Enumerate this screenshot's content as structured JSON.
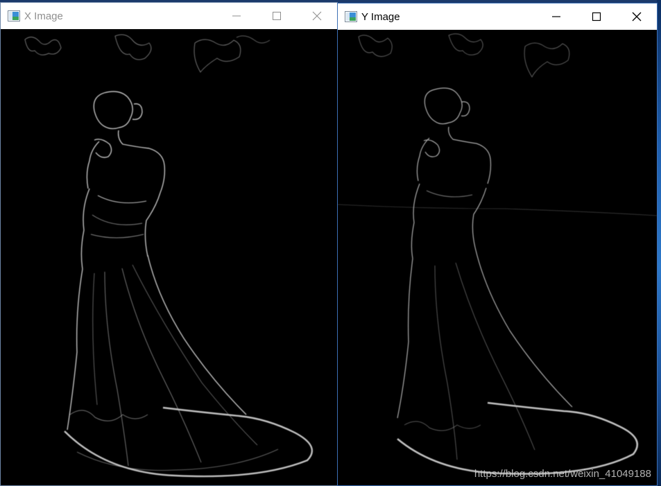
{
  "windows": [
    {
      "id": "x",
      "title": "X Image",
      "active": false,
      "buttons": {
        "minimize": "minimize",
        "maximize": "maximize",
        "close": "close"
      }
    },
    {
      "id": "y",
      "title": "Y Image",
      "active": true,
      "buttons": {
        "minimize": "minimize",
        "maximize": "maximize",
        "close": "close"
      }
    }
  ],
  "watermark": "https://blog.csdn.net/weixin_41049188",
  "colors": {
    "titlebar": "#ffffff",
    "inactive_title": "#8f8f8f",
    "active_title": "#000000",
    "image_background": "#000000",
    "edge_highlight": "#e8e8e8"
  },
  "icons": [
    "app-window-icon",
    "minimize-icon",
    "maximize-icon",
    "close-icon"
  ]
}
